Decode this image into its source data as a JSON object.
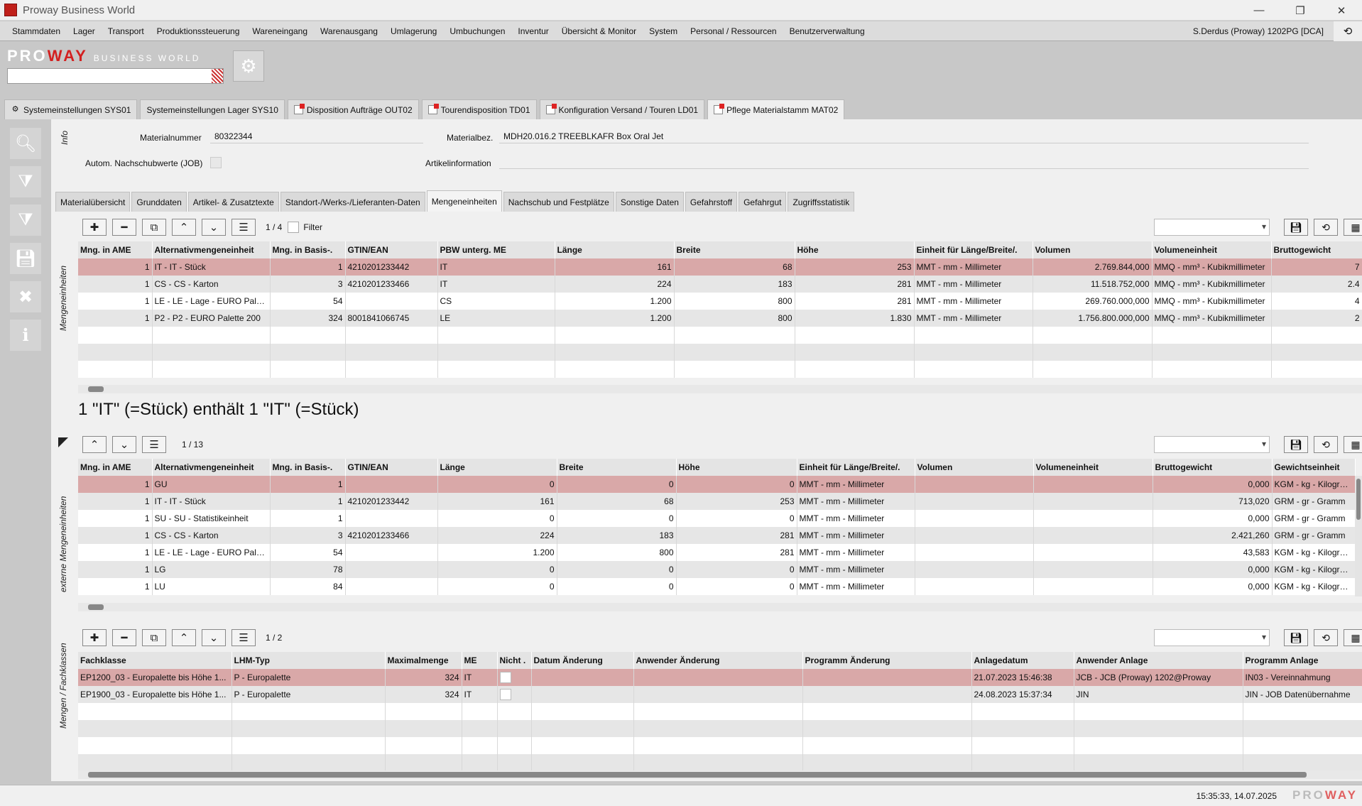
{
  "window": {
    "title": "Proway Business World"
  },
  "menu": {
    "items": [
      "Stammdaten",
      "Lager",
      "Transport",
      "Produktionssteuerung",
      "Wareneingang",
      "Warenausgang",
      "Umlagerung",
      "Umbuchungen",
      "Inventur",
      "Übersicht & Monitor",
      "System",
      "Personal / Ressourcen",
      "Benutzerverwaltung"
    ],
    "user": "S.Derdus (Proway) 1202PG [DCA]"
  },
  "logo": {
    "pro": "PRO",
    "way": "WAY",
    "sub": "BUSINESS WORLD"
  },
  "tabs": [
    "Systemeinstellungen SYS01",
    "Systemeinstellungen Lager SYS10",
    "Disposition Aufträge OUT02",
    "Tourendisposition TD01",
    "Konfiguration Versand / Touren LD01",
    "Pflege Materialstamm MAT02"
  ],
  "info": {
    "section": "Info",
    "materialnummer_label": "Materialnummer",
    "materialnummer": "80322344",
    "materialbez_label": "Materialbez.",
    "materialbez": "MDH20.016.2 TREEBLKAFR Box Oral Jet",
    "nachschub_label": "Autom. Nachschubwerte (JOB)",
    "artikelinfo_label": "Artikelinformation"
  },
  "subtabs": [
    "Materialübersicht",
    "Grunddaten",
    "Artikel- & Zusatztexte",
    "Standort-/Werks-/Lieferanten-Daten",
    "Mengeneinheiten",
    "Nachschub und Festplätze",
    "Sonstige Daten",
    "Gefahrstoff",
    "Gefahrgut",
    "Zugriffsstatistik"
  ],
  "panel1": {
    "label": "Mengeneinheiten",
    "pager": "1 /  4",
    "filter": "Filter",
    "columns": [
      "Mng. in AME",
      "Alternativmengeneinheit",
      "Mng. in Basis-.",
      "GTIN/EAN",
      "PBW unterg. ME",
      "Länge",
      "Breite",
      "Höhe",
      "Einheit für Länge/Breite/.",
      "Volumen",
      "Volumeneinheit",
      "Bruttogewicht"
    ],
    "rows": [
      [
        "1",
        "IT - IT - Stück",
        "1",
        "4210201233442",
        "IT",
        "161",
        "68",
        "253",
        "MMT - mm - Millimeter",
        "2.769.844,000",
        "MMQ - mm³ - Kubikmillimeter",
        "7"
      ],
      [
        "1",
        "CS - CS - Karton",
        "3",
        "4210201233466",
        "IT",
        "224",
        "183",
        "281",
        "MMT - mm - Millimeter",
        "11.518.752,000",
        "MMQ - mm³ - Kubikmillimeter",
        "2.4"
      ],
      [
        "1",
        "LE - LE - Lage - EURO Palette",
        "54",
        "",
        "CS",
        "1.200",
        "800",
        "281",
        "MMT - mm - Millimeter",
        "269.760.000,000",
        "MMQ - mm³ - Kubikmillimeter",
        "4"
      ],
      [
        "1",
        "P2 - P2 - EURO Palette 200",
        "324",
        "8001841066745",
        "LE",
        "1.200",
        "800",
        "1.830",
        "MMT - mm - Millimeter",
        "1.756.800.000,000",
        "MMQ - mm³ - Kubikmillimeter",
        "2"
      ]
    ]
  },
  "message": "1 \"IT\" (=Stück) enthält 1 \"IT\" (=Stück)",
  "panel2": {
    "label": "externe Mengeneinheiten",
    "pager": "1 / 13",
    "columns": [
      "Mng. in AME",
      "Alternativmengeneinheit",
      "Mng. in Basis-.",
      "GTIN/EAN",
      "Länge",
      "Breite",
      "Höhe",
      "Einheit für Länge/Breite/.",
      "Volumen",
      "Volumeneinheit",
      "Bruttogewicht",
      "Gewichtseinheit"
    ],
    "rows": [
      [
        "1",
        "GU",
        "1",
        "",
        "0",
        "0",
        "0",
        "MMT - mm - Millimeter",
        "",
        "",
        "0,000",
        "KGM - kg - Kilogramm"
      ],
      [
        "1",
        "IT - IT - Stück",
        "1",
        "4210201233442",
        "161",
        "68",
        "253",
        "MMT - mm - Millimeter",
        "",
        "",
        "713,020",
        "GRM - gr - Gramm"
      ],
      [
        "1",
        "SU - SU - Statistikeinheit",
        "1",
        "",
        "0",
        "0",
        "0",
        "MMT - mm - Millimeter",
        "",
        "",
        "0,000",
        "GRM - gr - Gramm"
      ],
      [
        "1",
        "CS - CS - Karton",
        "3",
        "4210201233466",
        "224",
        "183",
        "281",
        "MMT - mm - Millimeter",
        "",
        "",
        "2.421,260",
        "GRM - gr - Gramm"
      ],
      [
        "1",
        "LE - LE - Lage - EURO Palette",
        "54",
        "",
        "1.200",
        "800",
        "281",
        "MMT - mm - Millimeter",
        "",
        "",
        "43,583",
        "KGM - kg - Kilogramm"
      ],
      [
        "1",
        "LG",
        "78",
        "",
        "0",
        "0",
        "0",
        "MMT - mm - Millimeter",
        "",
        "",
        "0,000",
        "KGM - kg - Kilogramm"
      ],
      [
        "1",
        "LU",
        "84",
        "",
        "0",
        "0",
        "0",
        "MMT - mm - Millimeter",
        "",
        "",
        "0,000",
        "KGM - kg - Kilogramm"
      ]
    ]
  },
  "panel3": {
    "label": "Mengen / Fachklassen",
    "pager": "1 /  2",
    "columns": [
      "Fachklasse",
      "LHM-Typ",
      "Maximalmenge",
      "ME",
      "Nicht .",
      "Datum Änderung",
      "Anwender Änderung",
      "Programm Änderung",
      "Anlagedatum",
      "Anwender Anlage",
      "Programm Anlage"
    ],
    "rows": [
      [
        "EP1200_03 - Europalette bis Höhe 1...",
        "P - Europalette",
        "324",
        "IT",
        "",
        "",
        "",
        "",
        "21.07.2023 15:46:38",
        "JCB - JCB (Proway) 1202@Proway",
        "IN03 - Vereinnahmung"
      ],
      [
        "EP1900_03 - Europalette bis Höhe 1...",
        "P - Europalette",
        "324",
        "IT",
        "",
        "",
        "",
        "",
        "24.08.2023 15:37:34",
        "JIN",
        "JIN - JOB Datenübernahme"
      ]
    ]
  },
  "status": {
    "datetime": "15:35:33, 14.07.2025",
    "brand_pro": "PRO",
    "brand_way": "WAY"
  },
  "colors": {
    "selected_row": "#d9a8a8",
    "brand_red": "#d32020",
    "background": "#c8c8c8"
  }
}
